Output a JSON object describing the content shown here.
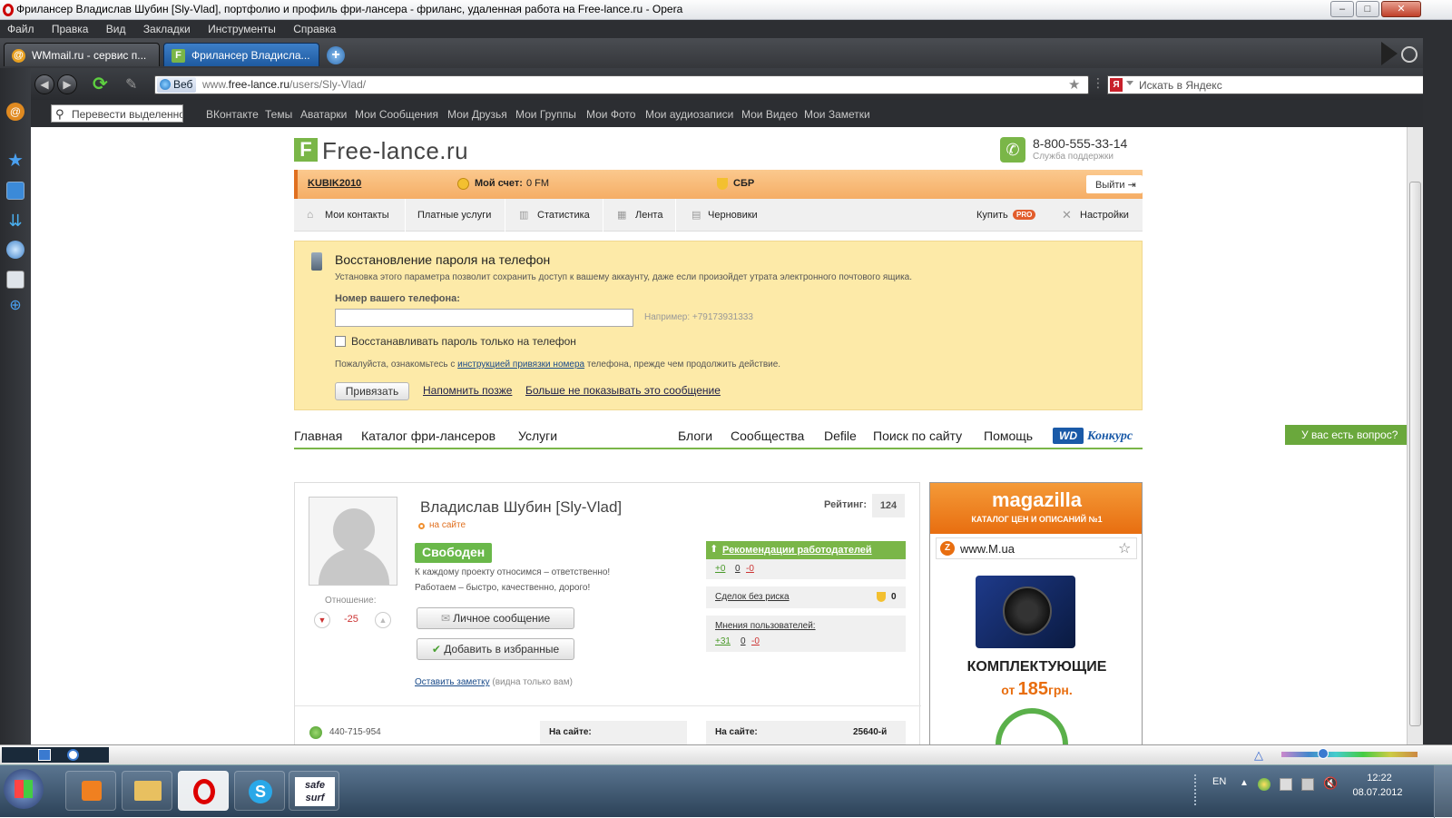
{
  "window": {
    "title": "Фрилансер Владислав Шубин [Sly-Vlad], портфолио и профиль фри-лансера - фриланс, удаленная работа на Free-lance.ru - Opera",
    "min_label": "–",
    "max_label": "□",
    "close_label": "✕"
  },
  "menu": [
    "Файл",
    "Правка",
    "Вид",
    "Закладки",
    "Инструменты",
    "Справка"
  ],
  "tabs": [
    {
      "label": "WMmail.ru - сервис п...",
      "icon": "at-icon",
      "active": false
    },
    {
      "label": "Фрилансер Владисла...",
      "icon": "free-lance-icon",
      "active": true
    }
  ],
  "address": {
    "web_label": "Веб",
    "url_prefix": "www.",
    "url_domain": "free-lance.ru",
    "url_path": "/users/Sly-Vlad/",
    "search_placeholder": "Искать в Яндекс"
  },
  "bookmarks": {
    "translate_placeholder": "Перевести выделенное",
    "items": [
      "ВКонтакте",
      "Темы",
      "Аватарки",
      "Мои Сообщения",
      "Мои Друзья",
      "Мои Группы",
      "Мои Фото",
      "Мои аудиозаписи",
      "Мои Видео",
      "Мои Заметки"
    ]
  },
  "site": {
    "logo_letter": "F",
    "logo_text": "Free-lance.ru",
    "phone": "8-800-555-33-14",
    "phone_caption": "Служба поддержки",
    "userbar": {
      "username": "KUBIK2010",
      "account_label": "Мой счет:",
      "account_value": "0 FM",
      "sbr_label": "СБР",
      "logout_label": "Выйти"
    },
    "subnav": [
      "Мои контакты",
      "Платные услуги",
      "Статистика",
      "Лента",
      "Черновики"
    ],
    "buy_label": "Купить",
    "pro_badge": "PRO",
    "settings_label": "Настройки",
    "phone_box": {
      "title": "Восстановление пароля на телефон",
      "desc": "Установка этого параметра позволит сохранить доступ к вашему аккаунту, даже если произойдет утрата электронного почтового ящика.",
      "field_label": "Номер вашего телефона:",
      "field_value": "",
      "example": "Например: +79173931333",
      "checkbox_label": "Восстанавливать пароль только на телефон",
      "note_before": "Пожалуйста, ознакомьтесь с ",
      "note_link": "инструкцией привязки номера",
      "note_after": " телефона, прежде чем продолжить действие.",
      "bind_button": "Привязать",
      "remind_link": "Напомнить позже",
      "hide_link": "Больше не показывать это сообщение"
    },
    "mainnav_left": [
      "Главная",
      "Каталог фри-лансеров",
      "Услуги"
    ],
    "mainnav_right": [
      "Блоги",
      "Сообщества",
      "Defile",
      "Поиск по сайту",
      "Помощь"
    ],
    "wd_badge": "WD",
    "contest_label": "Конкурс",
    "question_tab": "У вас есть вопрос?",
    "profile": {
      "name": "Владислав Шубин [Sly-Vlad]",
      "online": "на сайте",
      "rating_label": "Рейтинг:",
      "rating_value": "124",
      "status_badge": "Свободен",
      "about_1": "К каждому проекту относимся – ответственно!",
      "about_2": "Работаем – быстро, качественно, дорого!",
      "attitude_label": "Отношение:",
      "attitude_value": "-25",
      "message_button": "Личное сообщение",
      "favorite_button": "Добавить в избранные",
      "note_link": "Оставить заметку",
      "note_hint": "(видна только вам)",
      "recommend_label": "Рекомендации работодателей",
      "recommend_pos": "+0",
      "recommend_neu": "0",
      "recommend_neg": "-0",
      "deals_label": "Сделок без риска",
      "deals_value": "0",
      "opinions_label": "Мнения пользователей:",
      "opinions_pos": "+31",
      "opinions_neu": "0",
      "opinions_neg": "-0",
      "icq": "440-715-954",
      "onsite_label": "На сайте:",
      "onsite_label_2": "На сайте:",
      "onsite_rank": "25640-й"
    },
    "ad": {
      "brand": "magazilla",
      "tagline": "КАТАЛОГ ЦЕН И ОПИСАНИЙ №1",
      "site": "www.M.ua",
      "headline": "КОМПЛЕКТУЮЩИЕ",
      "price_prefix": "от",
      "price_value": "185",
      "price_suffix": "грн."
    }
  },
  "taskbar": {
    "lang": "EN",
    "time": "12:22",
    "date": "08.07.2012",
    "safesurf": "safe surf"
  },
  "colors": {
    "site_green": "#7ab648",
    "userbar_orange": "#f7b06a",
    "phone_box_bg": "#fdeaa8",
    "ad_orange": "#f08020"
  }
}
